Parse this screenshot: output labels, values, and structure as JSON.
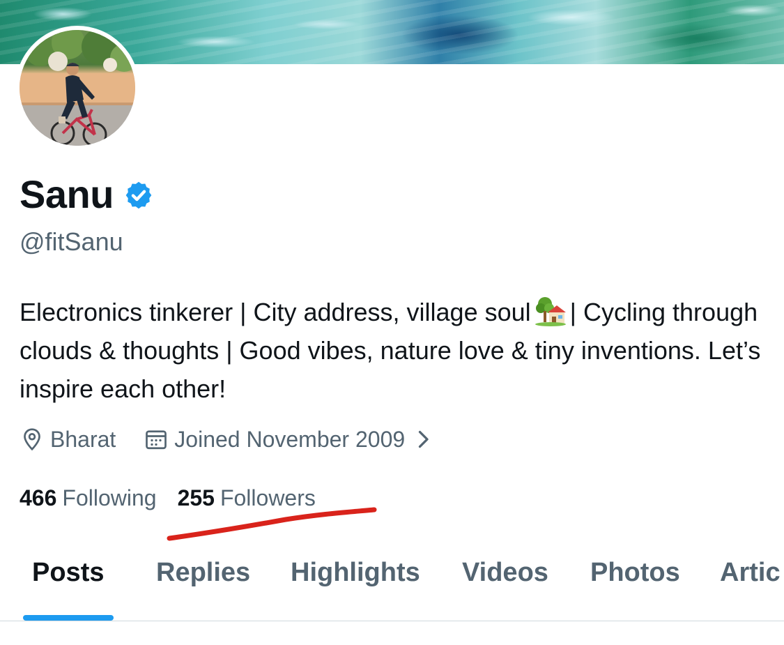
{
  "profile": {
    "name": "Sanu",
    "handle": "@fitSanu",
    "verified_icon": "verified-badge-icon",
    "bio": {
      "part1": "Electronics tinkerer | City address, village soul",
      "emoji": "house-with-garden-emoji",
      "part2": "| Cycling through clouds & thoughts | Good vibes, nature love & tiny inventions. Let’s inspire each other!"
    },
    "location": "Bharat",
    "joined": "Joined November 2009"
  },
  "stats": {
    "following_count": "466",
    "following_label": "Following",
    "followers_count": "255",
    "followers_label": "Followers"
  },
  "tabs": [
    {
      "label": "Posts",
      "active": true
    },
    {
      "label": "Replies",
      "active": false
    },
    {
      "label": "Highlights",
      "active": false
    },
    {
      "label": "Videos",
      "active": false
    },
    {
      "label": "Photos",
      "active": false
    },
    {
      "label": "Artic",
      "active": false
    }
  ],
  "colors": {
    "accent": "#1d9bf0",
    "text_primary": "#0f1419",
    "text_secondary": "#536471",
    "annotation": "#d9231b"
  }
}
